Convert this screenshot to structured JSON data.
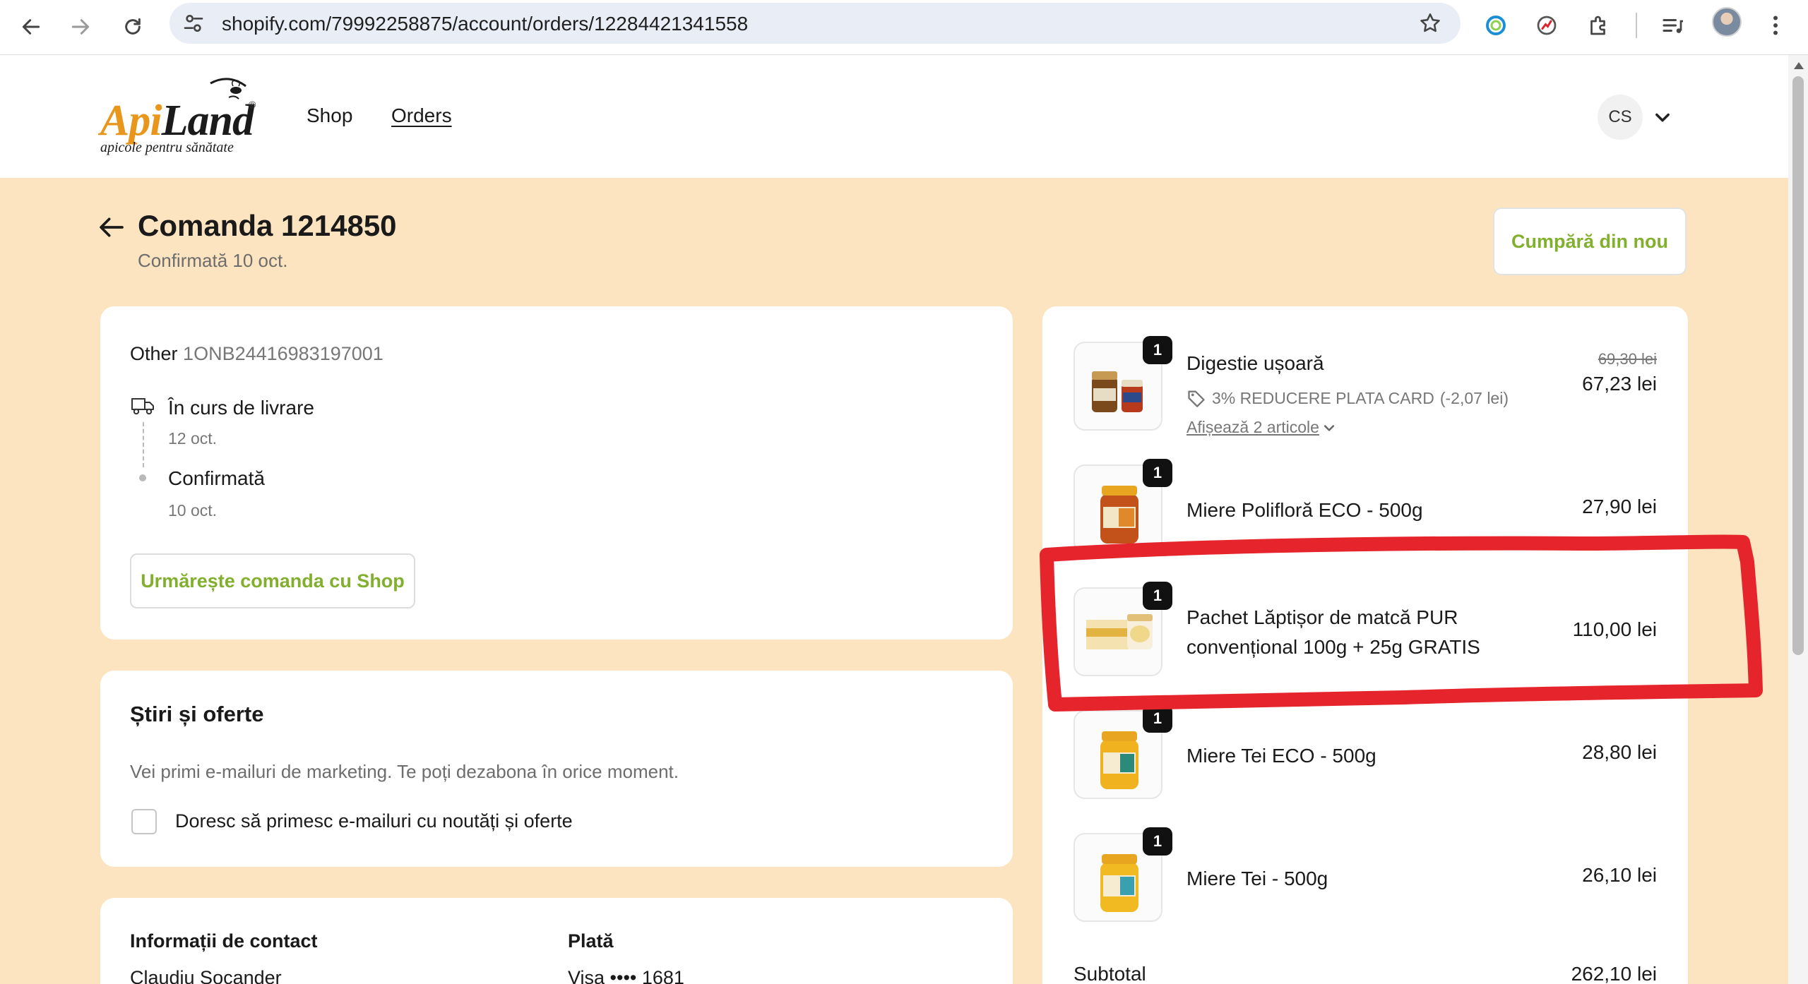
{
  "browser": {
    "url": "shopify.com/79992258875/account/orders/12284421341558"
  },
  "header": {
    "logo": {
      "brand_part1": "Api",
      "brand_part2": "Land",
      "registered": "®",
      "tagline": "apicole pentru sănătate"
    },
    "nav": {
      "shop": "Shop",
      "orders": "Orders"
    },
    "account_initials": "CS"
  },
  "order": {
    "title": "Comanda 1214850",
    "subtitle": "Confirmată 10 oct.",
    "buy_again": "Cumpără din nou"
  },
  "shipment": {
    "carrier_label": "Other",
    "tracking_number": "1ONB24416983197001",
    "status_1": "În curs de livrare",
    "status_1_date": "12 oct.",
    "status_2": "Confirmată",
    "status_2_date": "10 oct.",
    "track_button": "Urmărește comanda cu Shop"
  },
  "news": {
    "title": "Știri și oferte",
    "description": "Vei primi e-mailuri de marketing. Te poți dezabona în orice moment.",
    "checkbox_label": "Doresc să primesc e-mailuri cu noutăți și oferte"
  },
  "info": {
    "contact_label": "Informații de contact",
    "contact_value": "Claudiu Socander",
    "payment_label": "Plată",
    "payment_value": "Visa •••• 1681"
  },
  "items": [
    {
      "qty": "1",
      "name": "Digestie ușoară",
      "old_price": "69,30 lei",
      "price": "67,23 lei",
      "discount": "3% REDUCERE PLATA CARD",
      "discount_amount": "(-2,07 lei)",
      "show_more": "Afișează 2 articole"
    },
    {
      "qty": "1",
      "name": "Miere Polifloră ECO - 500g",
      "price": "27,90 lei"
    },
    {
      "qty": "1",
      "name": "Pachet Lăptișor de matcă PUR convențional 100g + 25g GRATIS",
      "price": "110,00 lei"
    },
    {
      "qty": "1",
      "name": "Miere Tei ECO - 500g",
      "price": "28,80 lei"
    },
    {
      "qty": "1",
      "name": "Miere Tei - 500g",
      "price": "26,10 lei"
    }
  ],
  "summary": {
    "subtotal_label": "Subtotal",
    "subtotal_value": "262,10 lei"
  },
  "colors": {
    "accent_green": "#82b02e",
    "page_bg": "#fde4c0",
    "highlight_red": "#e5242b",
    "logo_orange": "#e8961c"
  }
}
